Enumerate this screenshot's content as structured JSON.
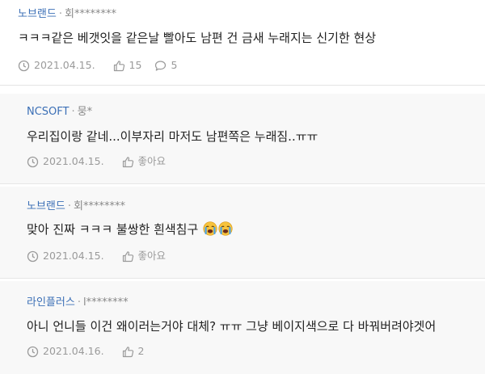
{
  "comments": [
    {
      "nickname": "노브랜드",
      "user_masked": "회********",
      "text": "ㅋㅋㅋ같은 베갯잇을 같은날 빨아도 남편 건 금새 누래지는 신기한 현상",
      "date": "2021.04.15.",
      "likes": "15",
      "replies": "5"
    }
  ],
  "replies": [
    {
      "nickname": "NCSOFT",
      "user_masked": "뭉*",
      "text": "우리집이랑 같네...이부자리 마저도 남편쪽은 누래짐..ㅠㅠ",
      "date": "2021.04.15.",
      "like_label": "좋아요"
    },
    {
      "nickname": "노브랜드",
      "user_masked": "회********",
      "text": "맞아 진짜 ㅋㅋㅋ 불쌍한 흰색침구",
      "date": "2021.04.15.",
      "like_label": "좋아요",
      "emojis": [
        "crying-face-emoji",
        "crying-face-emoji"
      ]
    },
    {
      "nickname": "라인플러스",
      "user_masked": "l********",
      "text": "아니 언니들 이건 왜이러는거야 대체? ㅠㅠ 그냥 베이지색으로 다 바꿔버려야겟어",
      "date": "2021.04.16.",
      "like_label": "2"
    }
  ],
  "separator": "·",
  "colors": {
    "nickname": "#3b6fb6",
    "meta": "#9a9a9a",
    "reply_background": "#f8f8f8",
    "emoji_face": "#f7c33c"
  },
  "icons": [
    "clock-icon",
    "thumbs-up-icon",
    "speech-bubble-icon"
  ]
}
